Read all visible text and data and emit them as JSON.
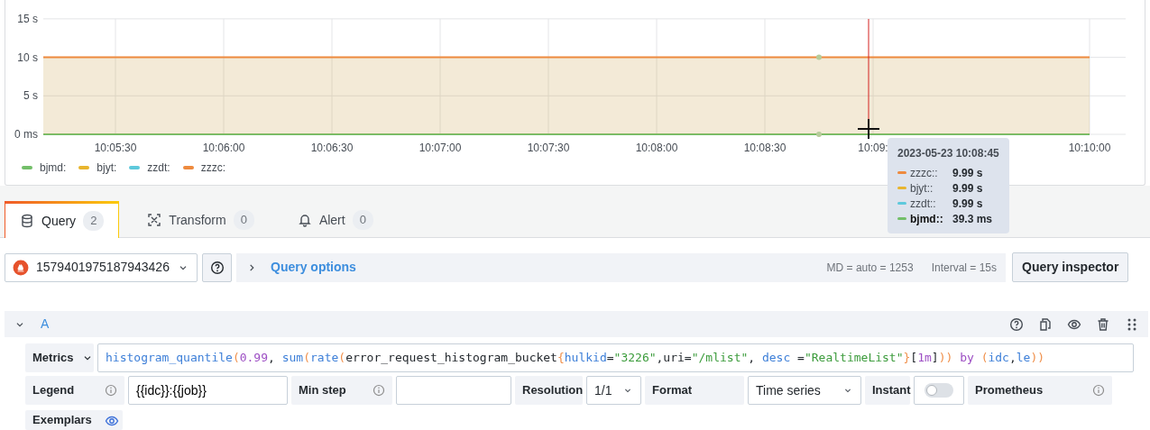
{
  "panel": {
    "chart_data": {
      "type": "area",
      "grid": true,
      "xlim": [
        36310,
        36610
      ],
      "ylim": [
        0,
        15
      ],
      "xticks": [
        {
          "value": 36330,
          "label": "10:05:30"
        },
        {
          "value": 36360,
          "label": "10:06:00"
        },
        {
          "value": 36390,
          "label": "10:06:30"
        },
        {
          "value": 36420,
          "label": "10:07:00"
        },
        {
          "value": 36450,
          "label": "10:07:30"
        },
        {
          "value": 36480,
          "label": "10:08:00"
        },
        {
          "value": 36510,
          "label": "10:08:30"
        },
        {
          "value": 36540,
          "label": "10:09:"
        },
        {
          "value": 36600,
          "label": "10:10:00"
        }
      ],
      "yticks": [
        {
          "value": 0,
          "label": "0 ms"
        },
        {
          "value": 5,
          "label": "5 s"
        },
        {
          "value": 10,
          "label": "10 s"
        },
        {
          "value": 15,
          "label": "15 s"
        }
      ],
      "x": [
        36310,
        36325,
        36340,
        36355,
        36370,
        36385,
        36400,
        36415,
        36430,
        36445,
        36460,
        36475,
        36490,
        36505,
        36520,
        36535,
        36550,
        36565,
        36580,
        36595,
        36600
      ],
      "series": [
        {
          "color": "#73bf69",
          "type": "line",
          "values": [
            0,
            0,
            0,
            0,
            0,
            0,
            0,
            0,
            0,
            0,
            0,
            0,
            0,
            0,
            0,
            0,
            0,
            0,
            0,
            0,
            0
          ]
        },
        {
          "color": "#ee8a3e",
          "type": "area",
          "values": [
            10,
            10,
            10,
            10,
            10,
            10,
            10,
            10,
            10,
            10,
            10,
            10,
            10,
            10,
            10,
            10,
            10,
            10,
            10,
            10,
            10
          ]
        }
      ]
    },
    "legend": [
      {
        "name": "bjmd:",
        "color": "#73bf69"
      },
      {
        "name": "bjyt:",
        "color": "#e8b52e"
      },
      {
        "name": "zzdt:",
        "color": "#5ec9dc"
      },
      {
        "name": "zzzc:",
        "color": "#ee8a3e"
      }
    ],
    "tooltip": {
      "title": "2023-05-23 10:08:45",
      "rows": [
        {
          "name": "zzzc::",
          "value": "9.99 s",
          "color": "#ee8a3e",
          "selected": false
        },
        {
          "name": "bjyt::",
          "value": "9.99 s",
          "color": "#e8b52e",
          "selected": false
        },
        {
          "name": "zzdt::",
          "value": "9.99 s",
          "color": "#5ec9dc",
          "selected": false
        },
        {
          "name": "bjmd::",
          "value": "39.3 ms",
          "color": "#73bf69",
          "selected": true
        }
      ]
    }
  },
  "tabs": [
    {
      "label": "Query",
      "count": "2",
      "kind": "query",
      "selected": true
    },
    {
      "label": "Transform",
      "count": "0",
      "kind": "transform",
      "selected": false
    },
    {
      "label": "Alert",
      "count": "0",
      "kind": "alert",
      "selected": false
    }
  ],
  "query_bar": {
    "datasource": "1579401975187943426",
    "options_label": "Query options",
    "md": "MD = auto = 1253",
    "interval": "Interval = 15s",
    "inspector_button": "Query inspector"
  },
  "query": {
    "ref": "A",
    "expanded": true,
    "metrics_label": "Metrics",
    "expression": [
      {
        "text": "histogram_quantile",
        "kind": "func"
      },
      {
        "text": "(",
        "kind": "paren"
      },
      {
        "text": "0.99",
        "kind": "number"
      },
      {
        "text": ", ",
        "kind": "plain"
      },
      {
        "text": "sum",
        "kind": "func"
      },
      {
        "text": "(",
        "kind": "paren"
      },
      {
        "text": "rate",
        "kind": "func"
      },
      {
        "text": "(",
        "kind": "paren"
      },
      {
        "text": "error_request_histogram_bucket",
        "kind": "plain"
      },
      {
        "text": "{",
        "kind": "paren"
      },
      {
        "text": "hulkid",
        "kind": "label"
      },
      {
        "text": "=",
        "kind": "plain"
      },
      {
        "text": "\"3226\"",
        "kind": "string"
      },
      {
        "text": ",uri=",
        "kind": "plain"
      },
      {
        "text": "\"/mlist\"",
        "kind": "string"
      },
      {
        "text": ", ",
        "kind": "plain"
      },
      {
        "text": "desc",
        "kind": "label"
      },
      {
        "text": " =",
        "kind": "plain"
      },
      {
        "text": "\"RealtimeList\"",
        "kind": "string"
      },
      {
        "text": "}",
        "kind": "paren"
      },
      {
        "text": "[",
        "kind": "plain"
      },
      {
        "text": "1m",
        "kind": "number"
      },
      {
        "text": "]",
        "kind": "plain"
      },
      {
        "text": "))",
        "kind": "paren"
      },
      {
        "text": " by ",
        "kind": "keyword"
      },
      {
        "text": "(",
        "kind": "paren"
      },
      {
        "text": "idc",
        "kind": "label"
      },
      {
        "text": ",",
        "kind": "plain"
      },
      {
        "text": "le",
        "kind": "label"
      },
      {
        "text": "))",
        "kind": "paren"
      }
    ],
    "legend_label": "Legend",
    "legend_value": "{{idc}}:{{job}}",
    "min_step_label": "Min step",
    "resolution_label": "Resolution",
    "resolution_value": "1/1",
    "format_label": "Format",
    "format_value": "Time series",
    "instant_label": "Instant",
    "instant_on": false,
    "type_label": "Prometheus",
    "exemplars_label": "Exemplars"
  }
}
